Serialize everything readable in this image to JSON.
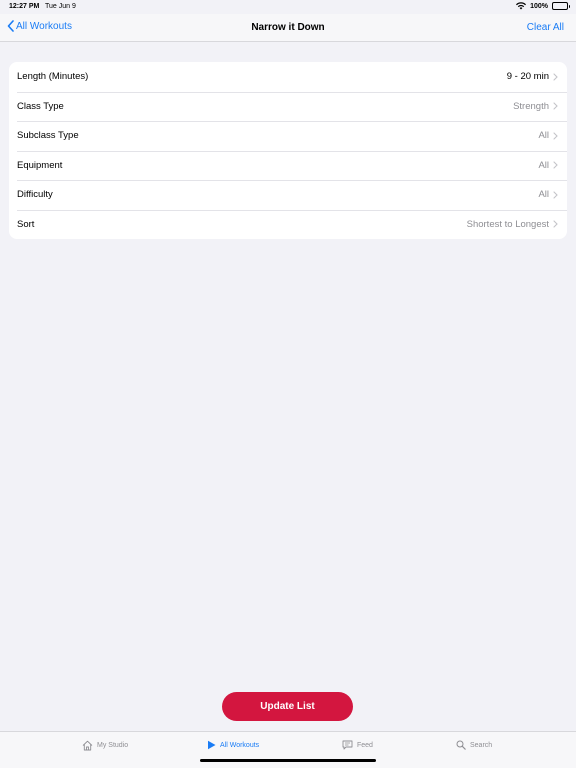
{
  "status_bar": {
    "time": "12:27 PM",
    "date": "Tue Jun 9",
    "battery": "100%"
  },
  "nav": {
    "back_label": "All Workouts",
    "title": "Narrow it Down",
    "clear_label": "Clear All"
  },
  "filters": [
    {
      "label": "Length (Minutes)",
      "value": "9 - 20 min"
    },
    {
      "label": "Class Type",
      "value": "Strength"
    },
    {
      "label": "Subclass Type",
      "value": "All"
    },
    {
      "label": "Equipment",
      "value": "All"
    },
    {
      "label": "Difficulty",
      "value": "All"
    },
    {
      "label": "Sort",
      "value": "Shortest to Longest"
    }
  ],
  "update_button": {
    "label": "Update List"
  },
  "tabs": [
    {
      "label": "My Studio",
      "icon": "house-icon"
    },
    {
      "label": "All Workouts",
      "icon": "play-icon"
    },
    {
      "label": "Feed",
      "icon": "chat-bubble-icon"
    },
    {
      "label": "Search",
      "icon": "search-icon"
    }
  ],
  "colors": {
    "accent": "#1a7cf5",
    "button": "#d3163f",
    "background": "#f2f2f7"
  }
}
